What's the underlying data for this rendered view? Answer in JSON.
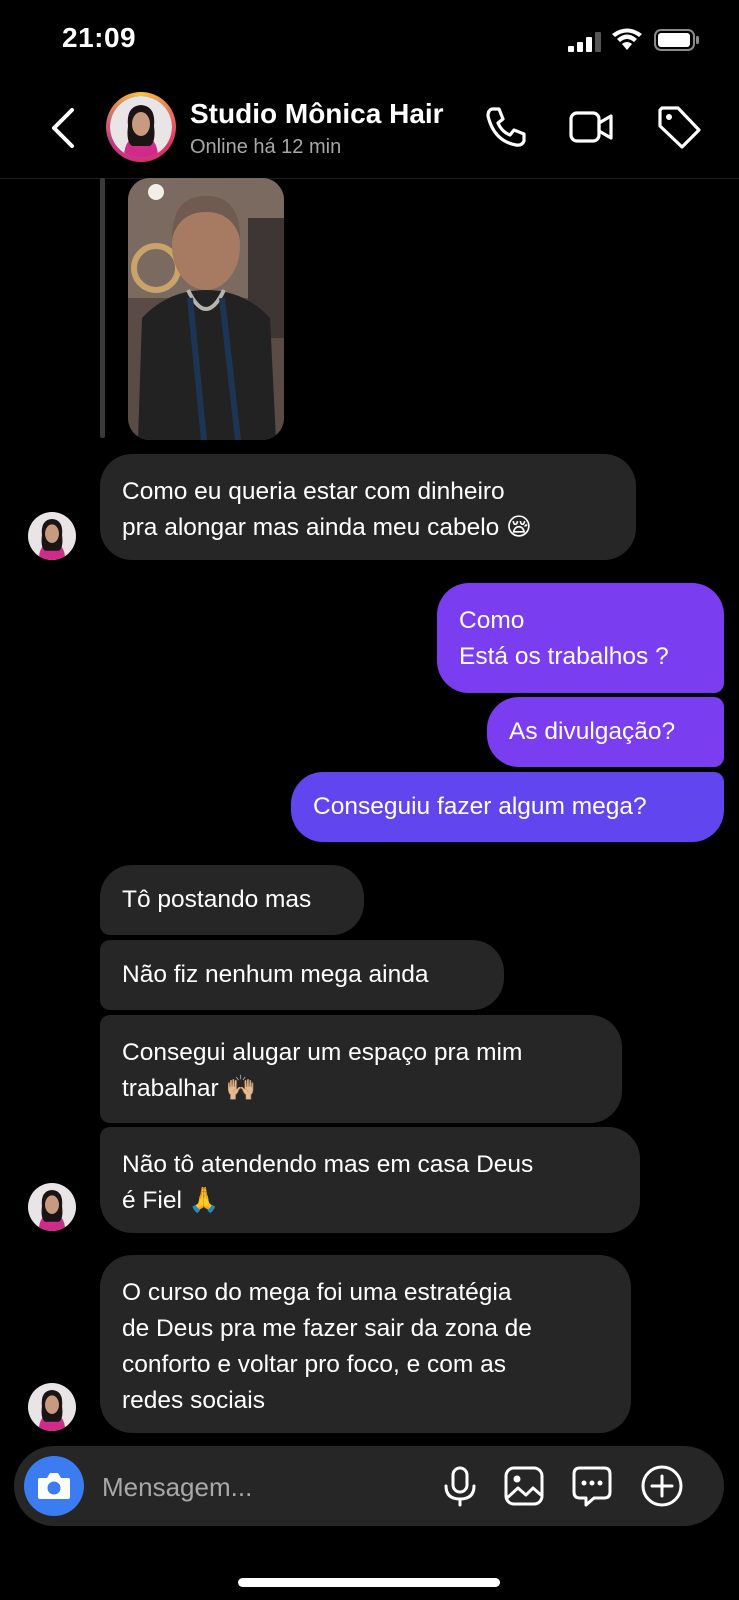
{
  "status_bar": {
    "time": "21:09"
  },
  "header": {
    "name": "Studio Mônica Hair",
    "subtitle": "Online há 12 min"
  },
  "messages": [
    {
      "id": "m1",
      "side": "in",
      "text": "Como eu queria estar com dinheiro\npra alongar mas ainda meu cabelo 😪"
    },
    {
      "id": "m2",
      "side": "out",
      "text": "Como\nEstá os trabalhos ?"
    },
    {
      "id": "m3",
      "side": "out",
      "text": "As divulgação?"
    },
    {
      "id": "m4",
      "side": "out",
      "text": "Conseguiu fazer algum mega?"
    },
    {
      "id": "m5",
      "side": "in",
      "text": "Tô postando mas"
    },
    {
      "id": "m6",
      "side": "in",
      "text": "Não fiz nenhum mega ainda"
    },
    {
      "id": "m7",
      "side": "in",
      "text": "Consegui alugar um espaço pra mim\ntrabalhar 🙌🏼"
    },
    {
      "id": "m8",
      "side": "in",
      "text": "Não tô atendendo mas em casa  Deus\né Fiel 🙏"
    },
    {
      "id": "m9",
      "side": "in",
      "text": "O curso do mega foi uma estratégia\nde Deus pra me fazer sair da zona de\nconforto e voltar pro foco, e com as\nredes sociais"
    }
  ],
  "composer": {
    "placeholder": "Mensagem..."
  },
  "colors": {
    "outgoing_purple": "#7a3df0",
    "outgoing_blue": "#6145ef",
    "incoming": "#262626",
    "camera_button": "#3b7cf0"
  },
  "icons": [
    "back-icon",
    "phone-icon",
    "video-call-icon",
    "tag-icon",
    "camera-icon",
    "microphone-icon",
    "gallery-icon",
    "sticker-icon",
    "add-icon"
  ]
}
